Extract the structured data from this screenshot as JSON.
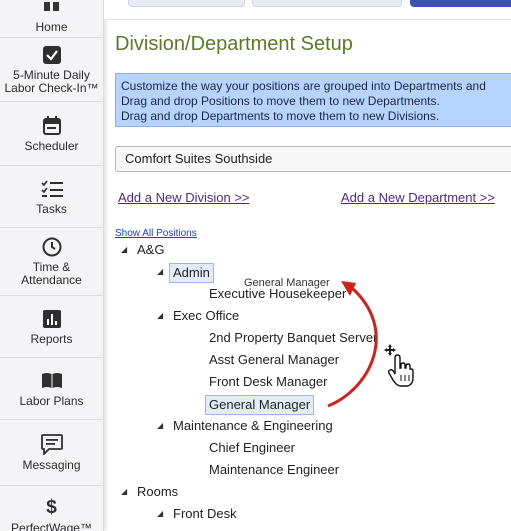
{
  "sidebar": {
    "items": [
      {
        "label": "Home",
        "icon": "home-icon"
      },
      {
        "label": "5-Minute Daily\nLabor Check-In™",
        "icon": "checkbox-icon"
      },
      {
        "label": "Scheduler",
        "icon": "calendar-icon"
      },
      {
        "label": "Tasks",
        "icon": "checklist-icon"
      },
      {
        "label": "Time &\nAttendance",
        "icon": "clock-icon"
      },
      {
        "label": "Reports",
        "icon": "bar-chart-icon"
      },
      {
        "label": "Labor Plans",
        "icon": "book-icon"
      },
      {
        "label": "Messaging",
        "icon": "message-icon"
      },
      {
        "label": "PerfectWage™",
        "icon": "dollar-icon"
      }
    ]
  },
  "page": {
    "title": "Division/Department Setup",
    "info_lines": [
      "Customize the way your positions are grouped into Departments and",
      "Drag and drop Positions to move them to new Departments.",
      "Drag and drop Departments to move them to new Divisions."
    ],
    "property_select": "Comfort Suites Southside",
    "add_division_link": "Add a New Division >>",
    "add_department_link": "Add a New Department >>",
    "show_all_positions": "Show All Positions"
  },
  "tree": {
    "div_ag": "A&G",
    "dept_admin": "Admin",
    "pos_exec_housekeeper": "Executive Housekeeper",
    "dept_exec_office": "Exec Office",
    "pos_2nd_banquet": "2nd Property Banquet Server",
    "pos_asst_gm": "Asst General Manager",
    "pos_front_desk_mgr": "Front Desk Manager",
    "pos_general_manager": "General Manager",
    "dept_maint_eng": "Maintenance & Engineering",
    "pos_chief_engineer": "Chief Engineer",
    "pos_maint_engineer": "Maintenance Engineer",
    "div_rooms": "Rooms",
    "dept_front_desk": "Front Desk"
  },
  "drag": {
    "ghost_label": "General Manager",
    "arrow_color": "#d0211c"
  }
}
